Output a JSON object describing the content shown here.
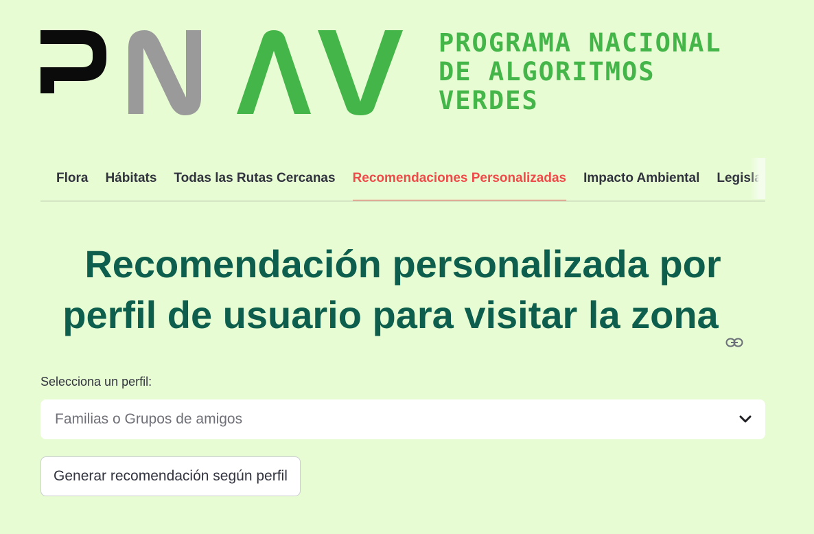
{
  "logo": {
    "mark_letters": [
      "P",
      "N",
      "A",
      "V"
    ],
    "lines": [
      "PROGRAMA NACIONAL",
      "DE ALGORITMOS",
      "VERDES"
    ],
    "colors": {
      "black": "#0b0b0b",
      "gray": "#9a9a9a",
      "green": "#44b548"
    }
  },
  "tabs": [
    {
      "label": "Flora",
      "active": false
    },
    {
      "label": "Hábitats",
      "active": false
    },
    {
      "label": "Todas las Rutas Cercanas",
      "active": false
    },
    {
      "label": "Recomendaciones Personalizadas",
      "active": true
    },
    {
      "label": "Impacto Ambiental",
      "active": false
    },
    {
      "label": "Legislación",
      "active": false
    }
  ],
  "heading": {
    "line1": "Recomendación personalizada por",
    "line2": "perfil de usuario para visitar la zona",
    "anchor_icon": "link-icon"
  },
  "profile_select": {
    "label": "Selecciona un perfil:",
    "value": "Familias o Grupos de amigos",
    "icon": "chevron-down-icon"
  },
  "generate_button": {
    "label": "Generar recomendación según perfil"
  },
  "colors": {
    "background": "#e7fcd2",
    "accent_active_tab": "#ef4a4a",
    "heading": "#0d5e4d",
    "logo_green": "#44b548"
  }
}
